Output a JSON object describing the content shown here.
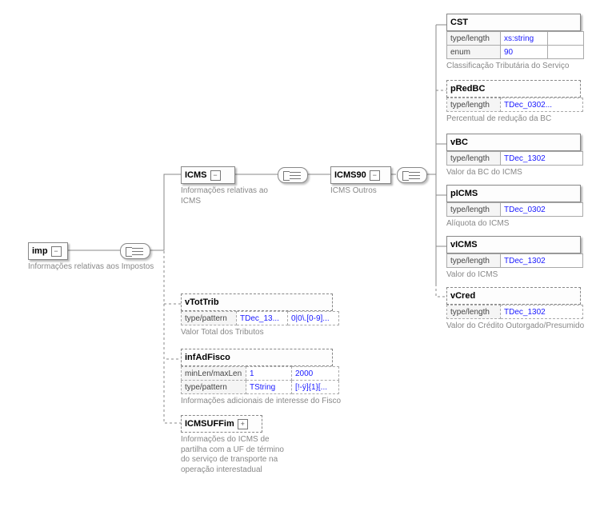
{
  "imp": {
    "name": "imp",
    "desc": "Informações relativas aos Impostos"
  },
  "icms": {
    "name": "ICMS",
    "desc": "Informações relativas ao ICMS"
  },
  "icms90": {
    "name": "ICMS90",
    "desc": "ICMS Outros"
  },
  "cst": {
    "name": "CST",
    "key1": "type/length",
    "val1": "xs:string",
    "key2": "enum",
    "val2": "90",
    "desc": "Classificação Tributária do Serviço"
  },
  "predbc": {
    "name": "pRedBC",
    "key": "type/length",
    "val": "TDec_0302...",
    "desc": "Percentual de redução da BC"
  },
  "vbc": {
    "name": "vBC",
    "key": "type/length",
    "val": "TDec_1302",
    "desc": "Valor da BC do ICMS"
  },
  "picms": {
    "name": "pICMS",
    "key": "type/length",
    "val": "TDec_0302",
    "desc": "Alíquota do ICMS"
  },
  "vicms": {
    "name": "vICMS",
    "key": "type/length",
    "val": "TDec_1302",
    "desc": "Valor do ICMS"
  },
  "vcred": {
    "name": "vCred",
    "key": "type/length",
    "val": "TDec_1302",
    "desc": "Valor do Crédito Outorgado/Presumido"
  },
  "vtottrib": {
    "name": "vTotTrib",
    "key": "type/pattern",
    "val1": "TDec_13...",
    "val2": "0|0\\.[0-9]...",
    "desc": "Valor Total dos Tributos"
  },
  "infadfisco": {
    "name": "infAdFisco",
    "key1": "minLen/maxLen",
    "val1a": "1",
    "val1b": "2000",
    "key2": "type/pattern",
    "val2a": "TString",
    "val2b": "[!-ÿ]{1}[...",
    "desc": "Informações adicionais de interesse do Fisco"
  },
  "icmsuffim": {
    "name": "ICMSUFFim",
    "desc": "Informações do ICMS de partilha com a UF de término do serviço de transporte na operação interestadual"
  },
  "expander_minus": "−",
  "expander_plus": "+"
}
